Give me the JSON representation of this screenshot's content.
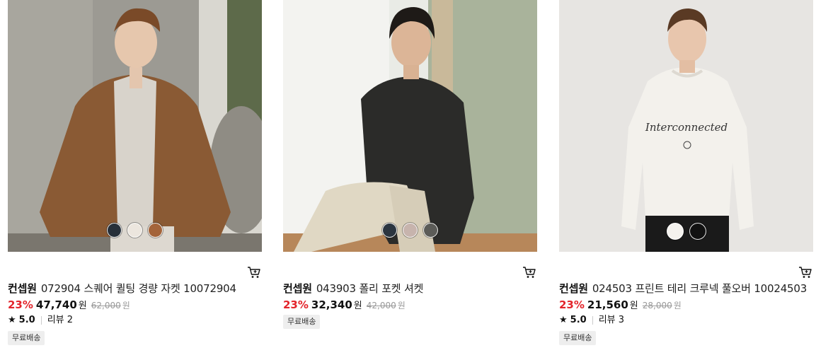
{
  "products": [
    {
      "brand": "컨셉원",
      "name": "072904 스퀘어 퀼팅 경량 자켓 10072904",
      "discount": "23%",
      "price": "47,740",
      "currency": "원",
      "original_price": "62,000",
      "original_currency": "원",
      "rating_star": "★",
      "rating": "5.0",
      "reviews": "리뷰 2",
      "badge": "무료배송",
      "swatches": [
        "#27303a",
        "#ece6de",
        "#a4643a"
      ]
    },
    {
      "brand": "컨셉원",
      "name": "043903 폴리 포켓 셔켓",
      "discount": "23%",
      "price": "32,340",
      "currency": "원",
      "original_price": "42,000",
      "original_currency": "원",
      "rating_star": "",
      "rating": "",
      "reviews": "",
      "badge": "무료배송",
      "swatches": [
        "#2b3540",
        "#c7b4ad",
        "#5c5c58"
      ]
    },
    {
      "brand": "컨셉원",
      "name": "024503 프린트 테리 크루넥 풀오버 10024503",
      "discount": "23%",
      "price": "21,560",
      "currency": "원",
      "original_price": "28,000",
      "original_currency": "원",
      "rating_star": "★",
      "rating": "5.0",
      "reviews": "리뷰 3",
      "badge": "무료배송",
      "swatches": [
        "#f4f2ee",
        "#111111"
      ]
    }
  ],
  "icons": {
    "cart": "cart-icon",
    "star": "star-icon"
  },
  "sweatshirt_print": "Interconnected"
}
